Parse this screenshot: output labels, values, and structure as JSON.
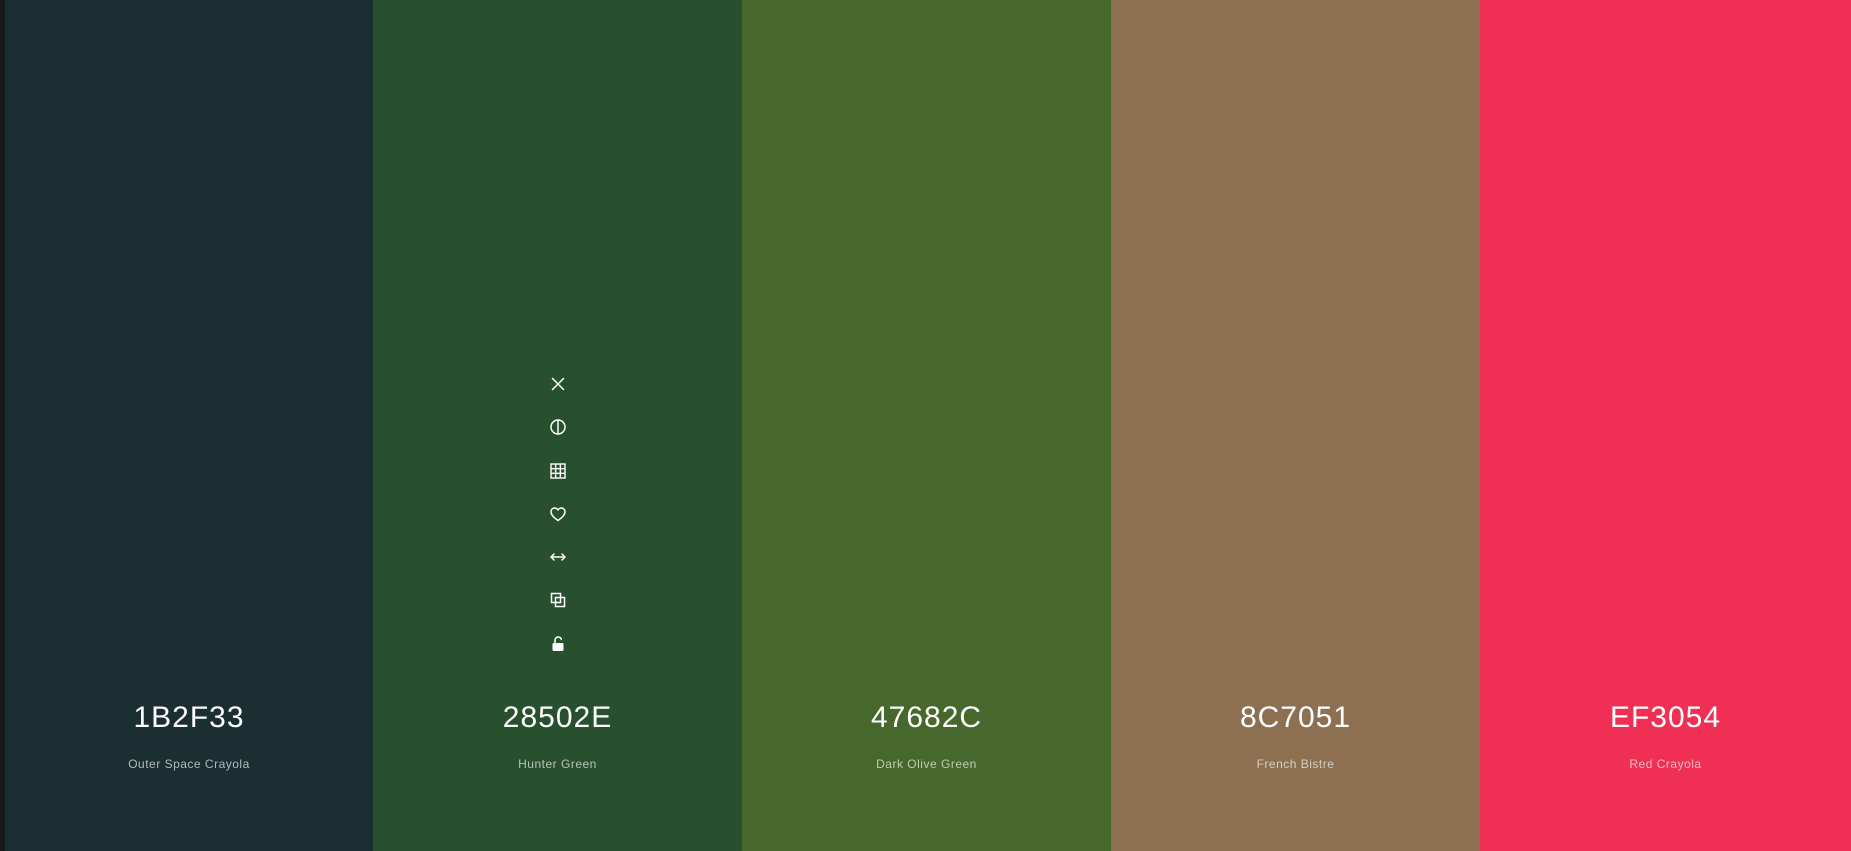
{
  "palette": {
    "colors": [
      {
        "hex": "1B2F33",
        "name": "Outer Space Crayola",
        "swatch_color": "#1B2F33"
      },
      {
        "hex": "28502E",
        "name": "Hunter Green",
        "swatch_color": "#28502E"
      },
      {
        "hex": "47682C",
        "name": "Dark Olive Green",
        "swatch_color": "#47682C"
      },
      {
        "hex": "8C7051",
        "name": "French Bistre",
        "swatch_color": "#8C7051"
      },
      {
        "hex": "EF3054",
        "name": "Red Crayola",
        "swatch_color": "#EF3054"
      }
    ],
    "hovered_swatch_index": 1,
    "swatch_tools": [
      "close-icon",
      "contrast-icon",
      "shades-grid-icon",
      "heart-icon",
      "drag-arrows-icon",
      "copy-icon",
      "unlock-icon"
    ],
    "tool_color": "#ffffff"
  }
}
